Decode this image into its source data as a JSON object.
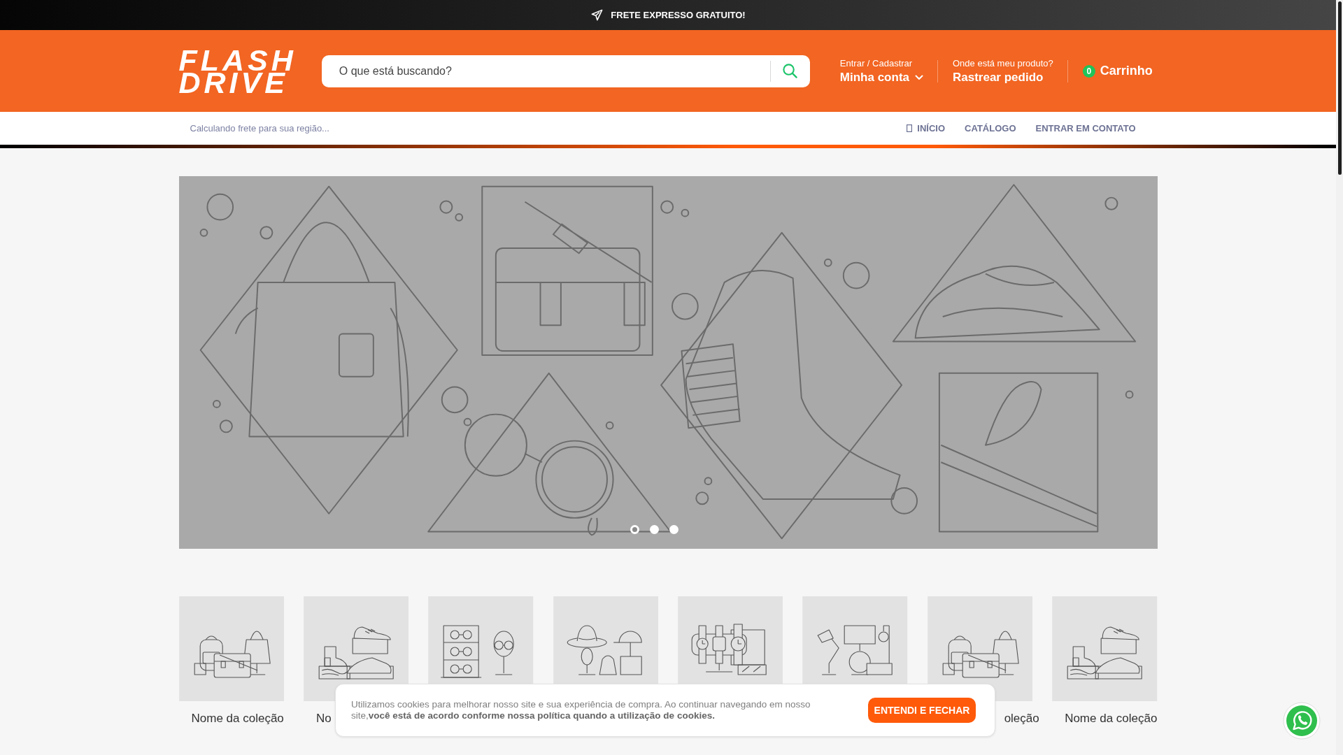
{
  "top_bar": {
    "text": "FRETE EXPRESSO GRATUITO!"
  },
  "header": {
    "logo": "FLASH DRIVE",
    "search": {
      "placeholder": "O que está buscando?"
    },
    "account": {
      "caption": "Entrar / Cadastrar",
      "label": "Minha conta"
    },
    "tracking": {
      "caption": "Onde está meu produto?",
      "label": "Rastrear pedido"
    },
    "cart": {
      "count": "0",
      "label": "Carrinho"
    }
  },
  "nav_bar": {
    "shipping_note": "Calculando frete para sua região...",
    "links": [
      {
        "label": "INÍCIO",
        "kind": "icon"
      },
      {
        "label": "CATÁLOGO",
        "kind": "plain"
      },
      {
        "label": "ENTRAR EM CONTATO",
        "kind": "plain"
      }
    ]
  },
  "banner": {
    "slides": [
      {
        "selected": true
      },
      {
        "selected": false
      },
      {
        "selected": false
      }
    ]
  },
  "collections": [
    {
      "kind": "bags",
      "label": "Nome da coleção"
    },
    {
      "kind": "shoes",
      "label": "No"
    },
    {
      "kind": "glasses"
    },
    {
      "kind": "hats"
    },
    {
      "kind": "watches"
    },
    {
      "kind": "lamps"
    },
    {
      "kind": "bags",
      "label": "oleção"
    },
    {
      "kind": "shoes",
      "label": "Nome da coleção"
    }
  ],
  "cookie_notice": {
    "text": "Utilizamos cookies para melhorar nosso site e sua experiência de compra. Ao continuar navegando em nosso site,**você está de acordo conforme nossa política quando a utilização de cookies.**",
    "button": "ENTENDI E FECHAR"
  }
}
